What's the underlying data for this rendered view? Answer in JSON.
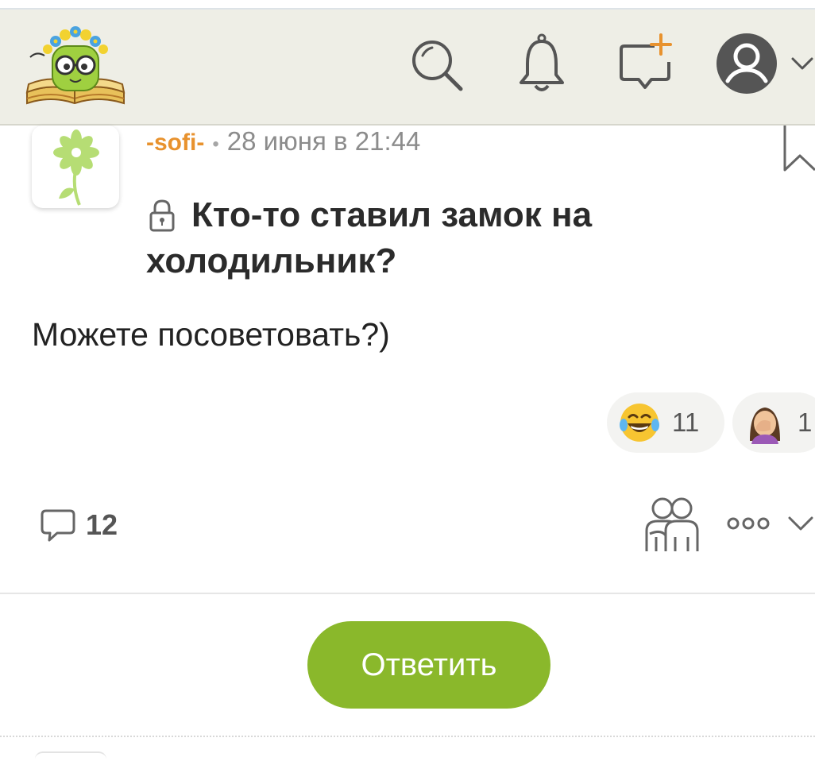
{
  "header": {
    "logo_icon": "bookworm-logo-icon",
    "icons": [
      "search-icon",
      "bell-icon",
      "new-post-icon",
      "user-avatar-icon",
      "chevron-down-icon"
    ]
  },
  "post": {
    "author": "-sofi-",
    "separator": "•",
    "date": "28 июня в 21:44",
    "title": "Кто-то ставил замок на холодильник?",
    "title_icon": "lock-icon",
    "body": "Можете посоветовать?)",
    "reactions": [
      {
        "emoji": "laughing-tears-emoji",
        "count": "11"
      },
      {
        "emoji": "facepalm-emoji",
        "count": "1"
      }
    ],
    "comments_count": "12"
  },
  "actions": {
    "reply_label": "Ответить"
  },
  "colors": {
    "accent_green": "#8ab82b",
    "author_orange": "#e8922e",
    "header_bg": "#eeeee6"
  }
}
